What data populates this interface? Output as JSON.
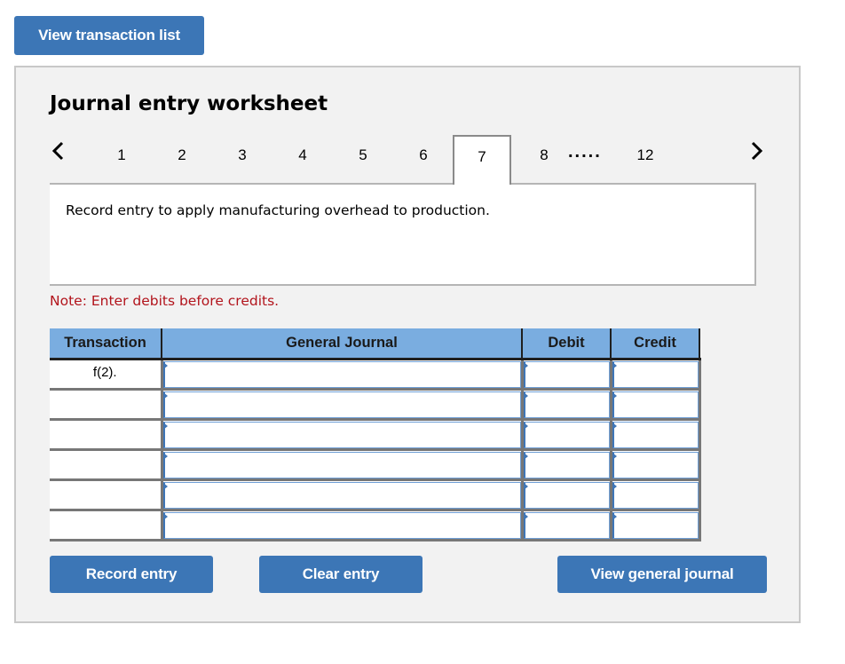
{
  "top_button": {
    "label": "View transaction list"
  },
  "worksheet": {
    "title": "Journal entry worksheet",
    "nav": {
      "prev_icon": "chevron-left-icon",
      "next_icon": "chevron-right-icon",
      "tabs": [
        "1",
        "2",
        "3",
        "4",
        "5",
        "6",
        "7",
        "8",
        "12"
      ],
      "active_tab": "7",
      "ellipsis": "....."
    },
    "description": "Record entry to apply manufacturing overhead to production.",
    "note": "Note: Enter debits before credits.",
    "table": {
      "headers": [
        "Transaction",
        "General Journal",
        "Debit",
        "Credit"
      ],
      "rows": [
        {
          "transaction": "f(2).",
          "account": "",
          "debit": "",
          "credit": ""
        },
        {
          "transaction": "",
          "account": "",
          "debit": "",
          "credit": ""
        },
        {
          "transaction": "",
          "account": "",
          "debit": "",
          "credit": ""
        },
        {
          "transaction": "",
          "account": "",
          "debit": "",
          "credit": ""
        },
        {
          "transaction": "",
          "account": "",
          "debit": "",
          "credit": ""
        },
        {
          "transaction": "",
          "account": "",
          "debit": "",
          "credit": ""
        }
      ]
    },
    "buttons": {
      "record": "Record entry",
      "clear": "Clear entry",
      "view_journal": "View general journal"
    }
  },
  "colors": {
    "button_bg": "#3c76b6",
    "header_bg": "#7aade0",
    "note_text": "#b2141c",
    "panel_bg": "#f2f2f2"
  }
}
